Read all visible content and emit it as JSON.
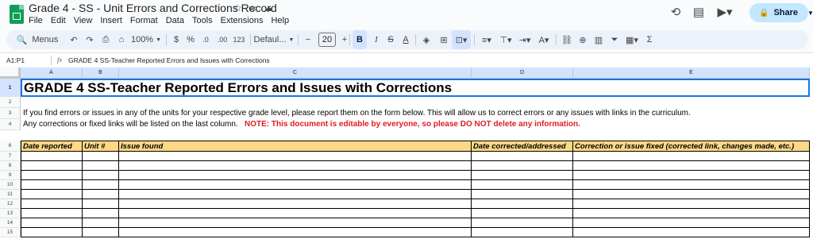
{
  "doc": {
    "title": "Grade 4 - SS - Unit Errors and Corrections  Record",
    "menu": [
      "File",
      "Edit",
      "View",
      "Insert",
      "Format",
      "Data",
      "Tools",
      "Extensions",
      "Help"
    ]
  },
  "share": {
    "label": "Share"
  },
  "toolbar": {
    "menus_label": "Menus",
    "zoom": "100%",
    "currency": "$",
    "percent": "%",
    "dec_decrease": ".0",
    "dec_increase": ".00",
    "number_format": "123",
    "font": "Defaul...",
    "font_size": "20",
    "minus": "−",
    "plus": "+",
    "bold": "B",
    "italic": "I",
    "strike": "S",
    "text_color": "A",
    "sigma": "Σ"
  },
  "formula_bar": {
    "name_box": "A1:P1",
    "fx": "fx",
    "content": "GRADE 4 SS-Teacher Reported Errors and Issues with Corrections"
  },
  "sheet": {
    "columns": [
      "A",
      "B",
      "C",
      "D",
      "E"
    ],
    "rows": [
      "1",
      "2",
      "3",
      "4",
      "6",
      "7",
      "8",
      "9",
      "10",
      "11",
      "12",
      "13",
      "14",
      "15"
    ],
    "title": "GRADE 4 SS-Teacher Reported Errors and Issues with Corrections",
    "line1": "If you find errors or issues in any of the units for your respective grade level, please report them on the form below.  This will allow us to correct errors or any issues with links in the curriculum.",
    "line2": "Any corrections or fixed links will be listed on the last column.",
    "note": "NOTE:  This document is editable by everyone, so please DO NOT delete any information.",
    "headers": [
      "Date reported",
      "Unit #",
      "Issue found",
      "Date corrected/addressed",
      "Correction or issue fixed (corrected link, changes made, etc.)"
    ]
  },
  "colors": {
    "accent": "#1a73e8",
    "header_fill": "#fdd983",
    "note": "#e01b24",
    "share_bg": "#c2e7ff"
  }
}
